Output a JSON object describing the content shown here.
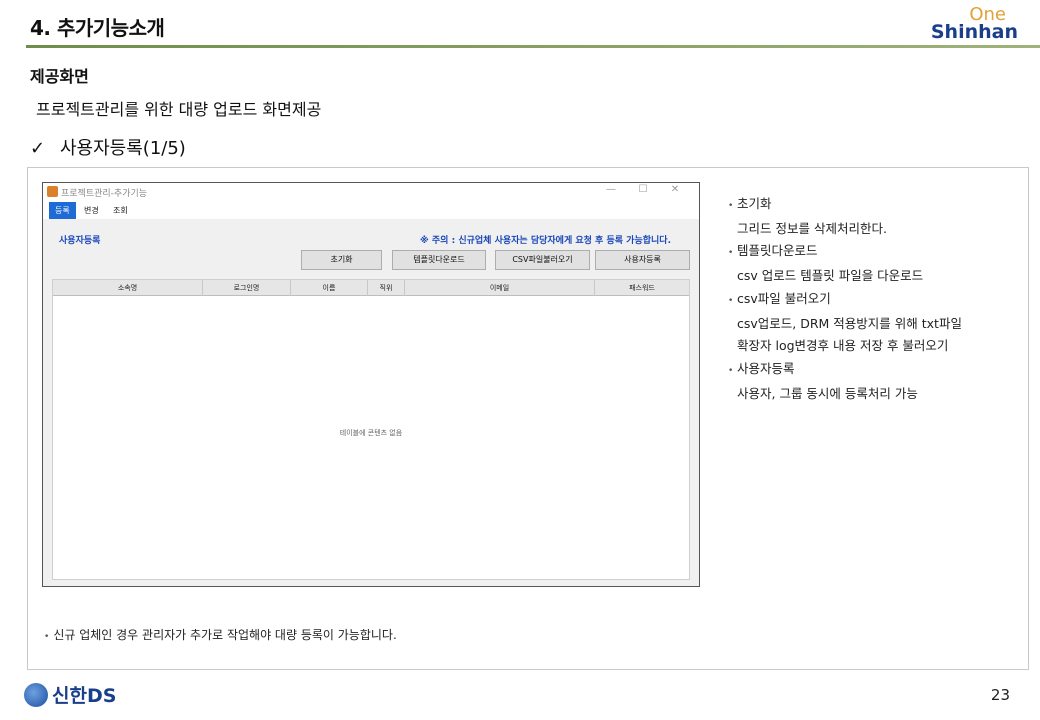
{
  "slide": {
    "title": "4. 추가기능소개",
    "section_heading": "제공화면",
    "section_sub": "프로젝트관리를 위한 대량 업로드 화면제공",
    "check_mark": "✓",
    "check_item": "사용자등록(1/5)",
    "page_number": "23"
  },
  "logo": {
    "line1": "One",
    "line2": "Shinhan"
  },
  "footer_logo": {
    "name": "신한DS"
  },
  "app": {
    "window_title": "프로젝트관리-추가기능",
    "controls": [
      "—",
      "☐",
      "✕"
    ],
    "tabs": [
      {
        "label": "등록",
        "active": true
      },
      {
        "label": "변경",
        "active": false
      },
      {
        "label": "조회",
        "active": false
      }
    ],
    "panel_title": "사용자등록",
    "notice": "※ 주의 : 신규업체 사용자는 담당자에게 요청 후 등록 가능합니다.",
    "buttons": [
      "초기화",
      "템플릿다운로드",
      "CSV파일불러오기",
      "사용자등록"
    ],
    "columns": [
      "소속명",
      "로그인명",
      "이름",
      "직위",
      "이메일",
      "패스워드"
    ],
    "empty_message": "테이블에 콘텐츠 없음"
  },
  "notes": [
    {
      "title": "초기화",
      "lines": [
        "그리드 정보를 삭제처리한다."
      ]
    },
    {
      "title": "템플릿다운로드",
      "lines": [
        "csv 업로드 템플릿 파일을 다운로드"
      ]
    },
    {
      "title": "csv파일 불러오기",
      "lines": [
        "csv업로드, DRM 적용방지를 위해 txt파일",
        "확장자 log변경후 내용 저장 후 불러오기"
      ]
    },
    {
      "title": "사용자등록",
      "lines": [
        "사용자, 그룹 동시에 등록처리 가능"
      ]
    }
  ],
  "bottom_note": "신규 업체인 경우 관리자가 추가로 작업해야 대량 등록이 가능합니다.",
  "colors": {
    "accent_rule": "#6f8d4a",
    "active_tab": "#1e6bd6",
    "notice_text": "#1a47b8",
    "brand_blue": "#1a3f8a",
    "brand_orange": "#e2a23a"
  }
}
